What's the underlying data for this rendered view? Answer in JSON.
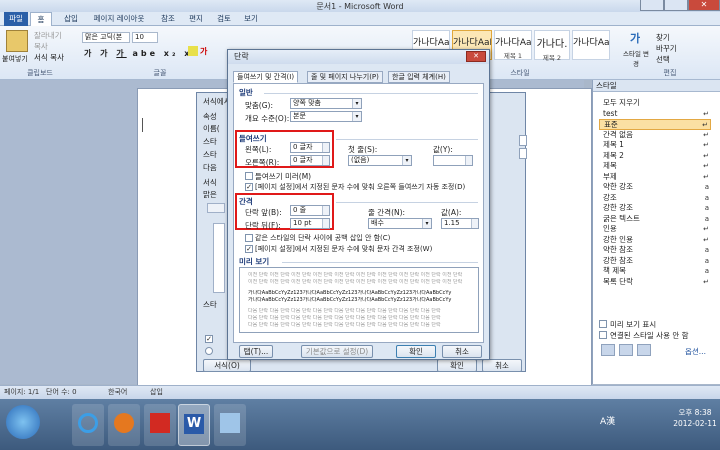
{
  "app": {
    "window_title": "문서1 - Microsoft Word"
  },
  "ribbon": {
    "tabs": [
      "파일",
      "홈",
      "삽입",
      "페이지 레이아웃",
      "참조",
      "편지",
      "검토",
      "보기"
    ],
    "paste_label": "붙여넣기",
    "cut": "잘라내기",
    "copy": "복사",
    "format_painter": "서식 복사",
    "font_name": "맑은 고딕(본",
    "font_size": "10",
    "group_clipboard": "클립보드",
    "group_font": "글꼴",
    "group_styles": "스타일",
    "group_edit": "편집",
    "styles": [
      {
        "preview": "가나다AaE",
        "name": "표준"
      },
      {
        "preview": "가나다AaE",
        "name": ""
      },
      {
        "preview": "가나다AaE",
        "name": "제목 1"
      },
      {
        "preview": "가나다.",
        "name": "제목 2"
      },
      {
        "preview": "가나다AaE",
        "name": ""
      }
    ],
    "change_styles": "스타일 변경",
    "find": "찾기",
    "replace": "바꾸기",
    "select": "선택"
  },
  "style_pane": {
    "title": "스타일",
    "items": [
      {
        "label": "모두 지우기",
        "sym": ""
      },
      {
        "label": "test",
        "sym": "↵"
      },
      {
        "label": "표준",
        "sym": "↵"
      },
      {
        "label": "간격 없음",
        "sym": "↵"
      },
      {
        "label": "제목 1",
        "sym": "↵"
      },
      {
        "label": "제목 2",
        "sym": "↵"
      },
      {
        "label": "제목",
        "sym": "↵"
      },
      {
        "label": "부제",
        "sym": "↵"
      },
      {
        "label": "약한 강조",
        "sym": "a"
      },
      {
        "label": "강조",
        "sym": "a"
      },
      {
        "label": "강한 강조",
        "sym": "a"
      },
      {
        "label": "굵은 텍스트",
        "sym": "a"
      },
      {
        "label": "인용",
        "sym": "↵"
      },
      {
        "label": "강한 인용",
        "sym": "↵"
      },
      {
        "label": "약한 참조",
        "sym": "a"
      },
      {
        "label": "강한 참조",
        "sym": "a"
      },
      {
        "label": "책 제목",
        "sym": "a"
      },
      {
        "label": "목록 단락",
        "sym": "↵"
      }
    ],
    "show_preview": "미리 보기 표시",
    "disable_linked": "연결된 스타일 사용 안 함",
    "options": "옵션..."
  },
  "status": {
    "page": "페이지: 1/1",
    "words": "단어 수: 0",
    "lang": "한국어",
    "insert": "삽입"
  },
  "taskbar": {
    "lang": "A漢",
    "time": "오후 8:38",
    "date": "2012-02-11"
  },
  "back_dialog": {
    "title": "서식에서",
    "labels": [
      "속성",
      "이름(",
      "스타",
      "스타",
      "다음",
      "서식",
      "맑은",
      "스타"
    ],
    "ok": "확인",
    "cancel": "취소",
    "format": "서식(O)"
  },
  "dialog": {
    "title": "단락",
    "tabs": [
      "들여쓰기 및 간격(I)",
      "줄 및 페이지 나누기(P)",
      "한글 입력 체계(H)"
    ],
    "general": "일반",
    "align_label": "맞춤(G):",
    "align_value": "양쪽 맞춤",
    "outline_label": "개요 수준(O):",
    "outline_value": "본문",
    "indent": "들여쓰기",
    "left_label": "왼쪽(L):",
    "left_value": "0 글자",
    "right_label": "오른쪽(R):",
    "right_value": "0 글자",
    "first_label": "첫 줄(S):",
    "first_value": "(없음)",
    "by_label": "값(Y):",
    "by_value": "",
    "mirror": "들여쓰기 미러(M)",
    "auto_indent": "[페이지 설정]에서 지정된 문자 수에 맞춰 오른쪽 들여쓰기 자동 조정(D)",
    "spacing": "간격",
    "before_label": "단락 앞(B):",
    "before_value": "0 줄",
    "after_label": "단락 뒤(F):",
    "after_value": "10 pt",
    "line_label": "줄 간격(N):",
    "line_value": "배수",
    "at_label": "값(A):",
    "at_value": "1.15",
    "no_space": "같은 스타일의 단락 사이에 공백 삽입 안 함(C)",
    "snap_grid": "[페이지 설정]에서 지정된 문자 수에 맞춰 문자 간격 조정(W)",
    "preview": "미리 보기",
    "preview_prev": "이전 단락 이전 단락 이전 단락 이전 단락 이전 단락 이전 단락 이전 단락 이전 단락 이전 단락 이전 단락",
    "preview_sample": "가나다AaBbCcYyZz123가나다AaBbCcYyZz123가나다AaBbCcYyZz123가나다AaBbCcYy",
    "preview_next": "다음 단락 다음 단락 다음 단락 다음 단락 다음 단락 다음 단락 다음 단락 다음 단락 다음 단락",
    "tabs_btn": "탭(T)...",
    "default_btn": "기본값으로 설정(D)",
    "ok": "확인",
    "cancel": "취소"
  }
}
